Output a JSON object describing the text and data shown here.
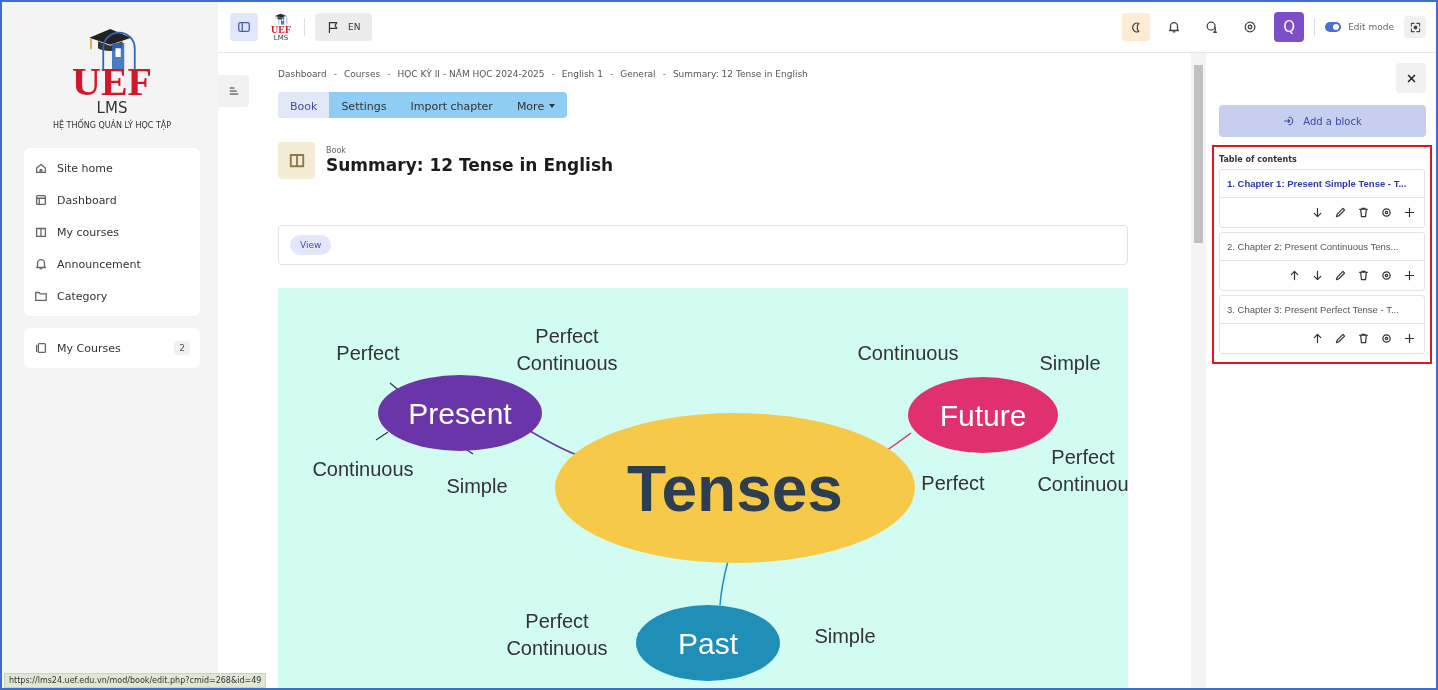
{
  "sidebar": {
    "logo": {
      "wordmark": "UEF",
      "product": "LMS",
      "tagline": "HỆ THỐNG QUẢN LÝ HỌC TẬP"
    },
    "nav": [
      {
        "label": "Site home"
      },
      {
        "label": "Dashboard"
      },
      {
        "label": "My courses"
      },
      {
        "label": "Announcement"
      },
      {
        "label": "Category"
      }
    ],
    "my_courses": {
      "label": "My Courses",
      "count": "2"
    }
  },
  "topbar": {
    "logo": {
      "wordmark": "UEF",
      "product": "LMS"
    },
    "language": "EN",
    "avatar": "Q",
    "edit_mode": {
      "label": "Edit mode",
      "on": true
    }
  },
  "breadcrumb": [
    {
      "label": "Dashboard"
    },
    {
      "separator": "-",
      "label": "Courses"
    },
    {
      "separator": "-",
      "label": "HỌC KỲ II - NĂM HỌC 2024-2025"
    },
    {
      "separator": "-",
      "label": "English 1"
    },
    {
      "separator": "-",
      "label": "General"
    },
    {
      "separator": "-",
      "label": "Summary: 12 Tense in English"
    }
  ],
  "tabs": [
    {
      "label": "Book",
      "selected": true,
      "dropdown": false
    },
    {
      "label": "Settings",
      "selected": false,
      "dropdown": false
    },
    {
      "label": "Import chapter",
      "selected": false,
      "dropdown": false
    },
    {
      "label": "More",
      "selected": false,
      "dropdown": true
    }
  ],
  "page": {
    "kind_label": "Book",
    "title": "Summary: 12 Tense in English",
    "view_button": "View"
  },
  "mind_map": {
    "center": "Tenses",
    "branches": [
      {
        "label": "Present",
        "color": "#6a35a8",
        "leaves": [
          [
            "Perfect"
          ],
          [
            "Perfect",
            "Continuous"
          ],
          [
            "Continuous"
          ],
          [
            "Simple"
          ]
        ]
      },
      {
        "label": "Future",
        "color": "#e0306e",
        "leaves": [
          [
            "Continuous"
          ],
          [
            "Simple"
          ],
          [
            "Perfect"
          ],
          [
            "Perfect",
            "Continuou"
          ]
        ]
      },
      {
        "label": "Past",
        "color": "#1f8fb8",
        "leaves": [
          [
            "Perfect",
            "Continuous"
          ],
          [
            "Simple"
          ]
        ]
      }
    ]
  },
  "drawer": {
    "add_block": "Add a block",
    "toc": {
      "title": "Table of contents",
      "chapters": [
        {
          "title": "1. Chapter 1: Present Simple Tense - T...",
          "selected": true,
          "actions": [
            {
              "kind": "down"
            },
            {
              "kind": "edit"
            },
            {
              "kind": "delete"
            },
            {
              "kind": "view"
            },
            {
              "kind": "add"
            }
          ]
        },
        {
          "title": "2. Chapter 2: Present Continuous Tens...",
          "selected": false,
          "actions": [
            {
              "kind": "up"
            },
            {
              "kind": "down"
            },
            {
              "kind": "edit"
            },
            {
              "kind": "delete"
            },
            {
              "kind": "view"
            },
            {
              "kind": "add"
            }
          ]
        },
        {
          "title": "3. Chapter 3: Present Perfect Tense - T...",
          "selected": false,
          "actions": [
            {
              "kind": "up"
            },
            {
              "kind": "edit"
            },
            {
              "kind": "delete"
            },
            {
              "kind": "view"
            },
            {
              "kind": "add"
            }
          ]
        }
      ]
    }
  },
  "status_bar": {
    "url": "https://lms24.uef.edu.vn/mod/book/edit.php?cmid=268&id=49"
  }
}
